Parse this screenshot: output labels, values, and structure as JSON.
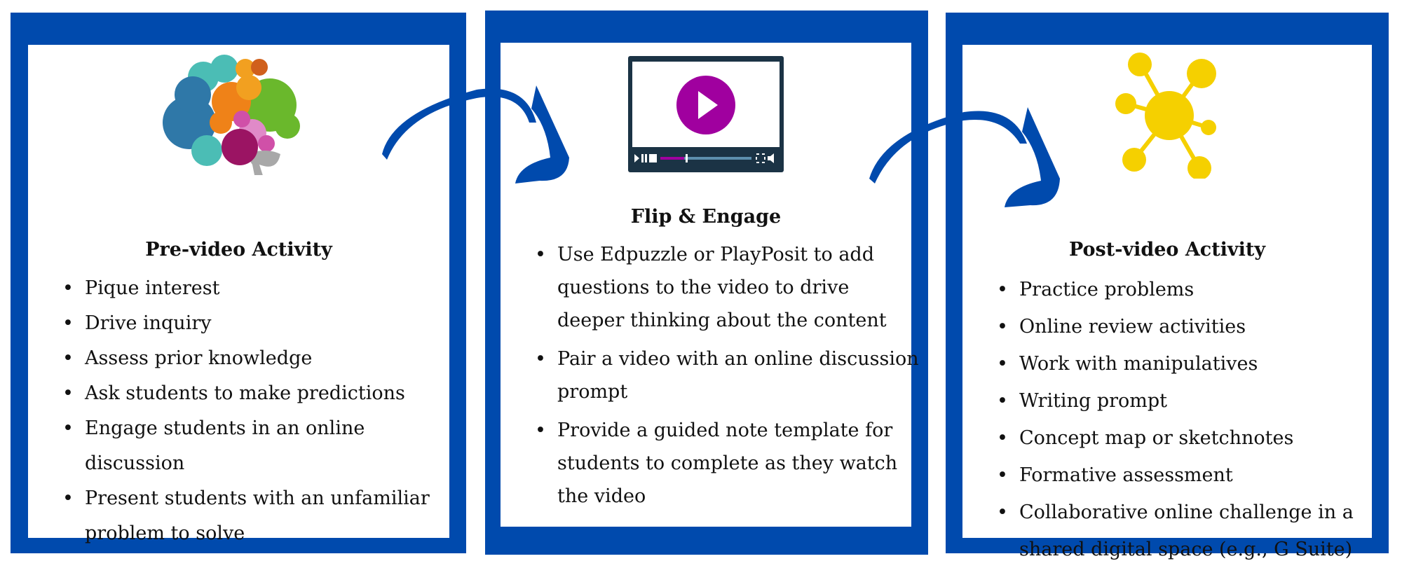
{
  "colors": {
    "border": "#004aad",
    "play": "#a0009f",
    "hub": "#f5d000",
    "player": "#1b3345"
  },
  "panels": [
    {
      "title": "Pre-video Activity",
      "icon": "brain-icon",
      "items": [
        "Pique interest",
        "Drive inquiry",
        "Assess prior knowledge",
        "Ask students to make predictions",
        "Engage students in an online discussion",
        "Present students with an unfamiliar problem to solve"
      ]
    },
    {
      "title": "Flip & Engage",
      "icon": "video-player-icon",
      "items": [
        "Use Edpuzzle or PlayPosit to add questions to the video to drive deeper thinking about the content",
        "Pair a video with an online discussion prompt",
        "Provide a guided note template for students to complete as they watch the video"
      ]
    },
    {
      "title": "Post-video Activity",
      "icon": "network-hub-icon",
      "items": [
        "Practice problems",
        "Online review activities",
        "Work with manipulatives",
        "Writing prompt",
        "Concept map or sketchnotes",
        "Formative assessment",
        "Collaborative online challenge in a shared digital space (e.g., G Suite)"
      ]
    }
  ]
}
